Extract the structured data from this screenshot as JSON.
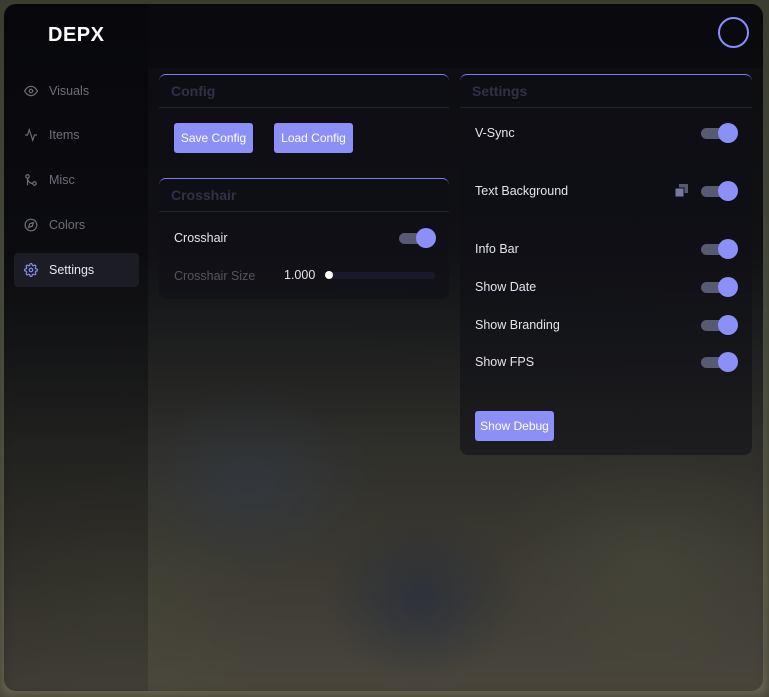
{
  "app": {
    "logo": "DEPX"
  },
  "sidebar": {
    "items": [
      {
        "label": "Visuals",
        "icon": "eye-icon"
      },
      {
        "label": "Items",
        "icon": "activity-icon"
      },
      {
        "label": "Misc",
        "icon": "git-merge-icon"
      },
      {
        "label": "Colors",
        "icon": "compass-icon"
      },
      {
        "label": "Settings",
        "icon": "gear-icon",
        "active": true
      }
    ]
  },
  "config_panel": {
    "title": "Config",
    "save_label": "Save Config",
    "load_label": "Load Config"
  },
  "crosshair_panel": {
    "title": "Crosshair",
    "crosshair_label": "Crosshair",
    "crosshair_on": true,
    "size_label": "Crosshair Size",
    "size_value": "1.000",
    "size_fraction": 0.0
  },
  "settings_panel": {
    "title": "Settings",
    "rows": [
      {
        "label": "V-Sync",
        "on": true
      },
      {
        "label": "Text Background",
        "on": true,
        "copy_icon": "copy-icon"
      },
      {
        "label": "Info Bar",
        "on": true
      },
      {
        "label": "Show Date",
        "on": true
      },
      {
        "label": "Show Branding",
        "on": true
      },
      {
        "label": "Show FPS",
        "on": true
      }
    ],
    "debug_label": "Show Debug"
  },
  "colors": {
    "accent": "#8b8ff8",
    "panel_border": "#7b7ef0"
  }
}
